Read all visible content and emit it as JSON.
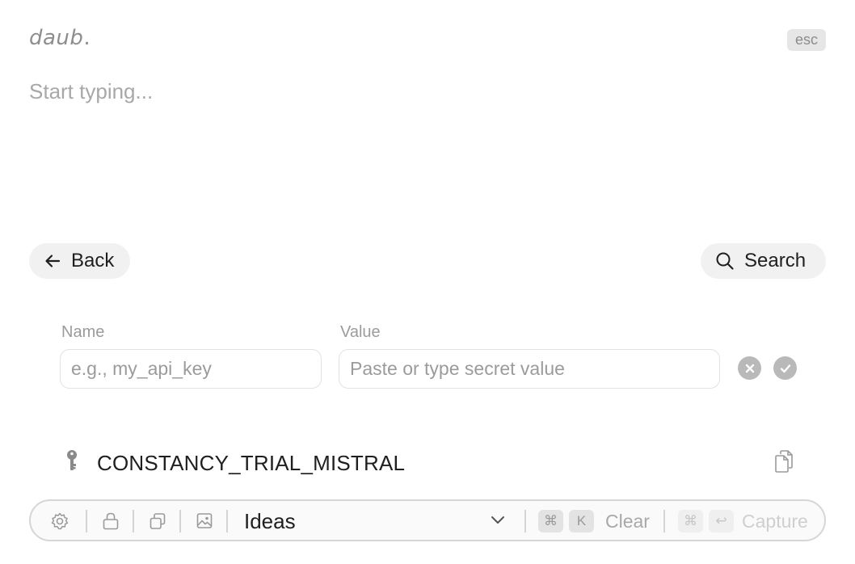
{
  "app": {
    "logo_text": "daub",
    "logo_dot": ".",
    "esc_label": "esc"
  },
  "composer": {
    "placeholder": "Start typing..."
  },
  "nav": {
    "back_label": "Back",
    "search_label": "Search"
  },
  "secret_form": {
    "name_label": "Name",
    "name_placeholder": "e.g., my_api_key",
    "value_label": "Value",
    "value_placeholder": "Paste or type secret value"
  },
  "secrets": [
    {
      "name": "CONSTANCY_TRIAL_MISTRAL",
      "icon": "key-icon"
    }
  ],
  "toolbar": {
    "icons": [
      "gear-icon",
      "lock-icon",
      "duplicate-icon",
      "image-icon"
    ],
    "notebook_selected": "Ideas",
    "clear_shortcut_mod": "⌘",
    "clear_shortcut_key": "K",
    "clear_label": "Clear",
    "capture_shortcut_mod": "⌘",
    "capture_shortcut_key": "↩",
    "capture_label": "Capture"
  },
  "colors": {
    "background": "#ffffff",
    "muted": "#9b9b9b",
    "pill": "#f1f1f1",
    "text": "#1f1f1f"
  }
}
